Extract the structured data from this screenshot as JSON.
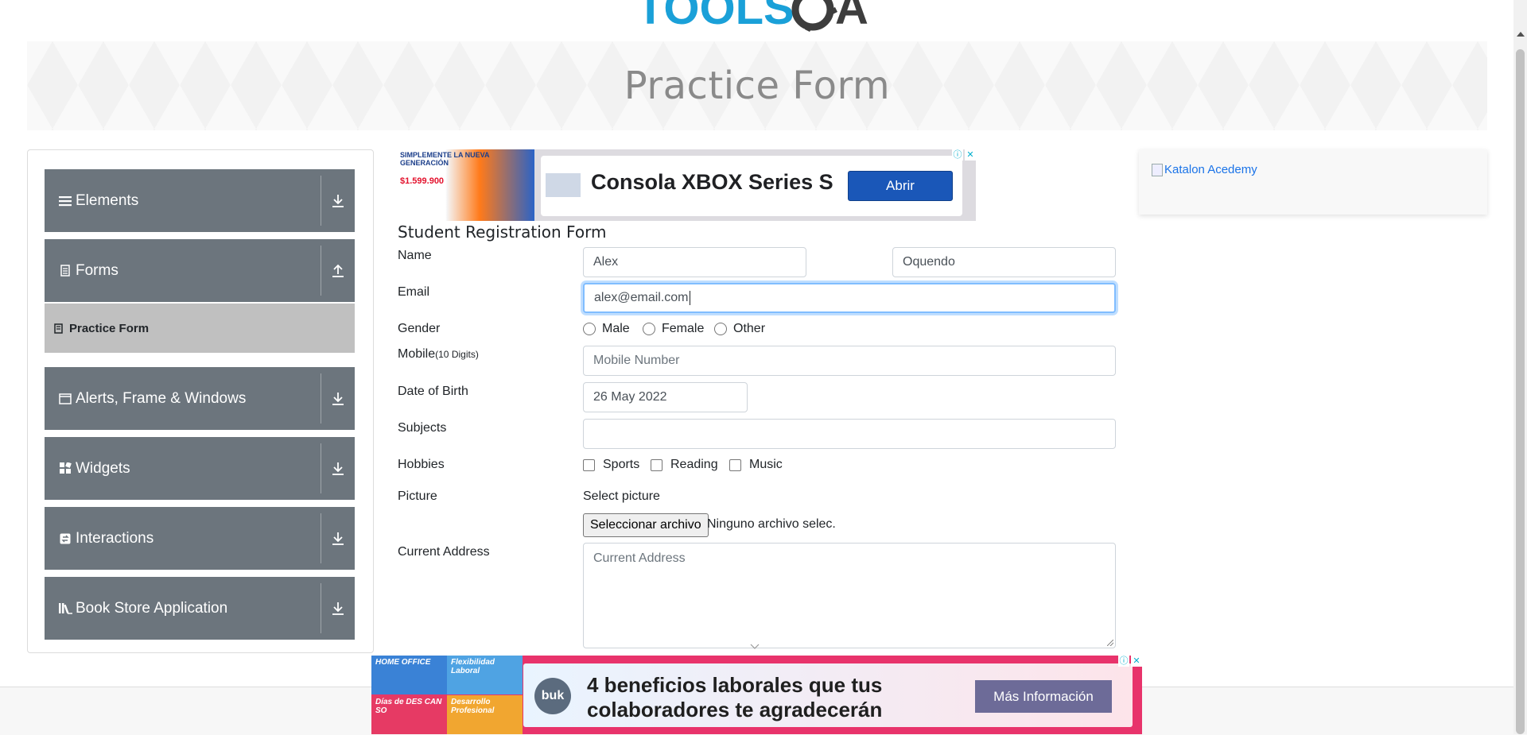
{
  "header": {
    "logo_alt": "TOOLSQA"
  },
  "banner": {
    "title": "Practice Form"
  },
  "sidebar": {
    "groups": [
      {
        "label": "Elements",
        "icon": "menu-lines-icon",
        "arrow": "download-icon"
      },
      {
        "label": "Forms",
        "icon": "document-icon",
        "arrow": "upload-icon"
      },
      {
        "label": "Alerts, Frame & Windows",
        "icon": "window-icon",
        "arrow": "download-icon"
      },
      {
        "label": "Widgets",
        "icon": "widgets-grid-icon",
        "arrow": "download-icon"
      },
      {
        "label": "Interactions",
        "icon": "interactions-icon",
        "arrow": "download-icon"
      },
      {
        "label": "Book Store Application",
        "icon": "books-icon",
        "arrow": "download-icon"
      }
    ],
    "active_sub_item": "Practice Form"
  },
  "ads": {
    "top": {
      "thumb_line1": "SIMPLEMENTE LA NUEVA GENERACIÓN",
      "thumb_price": "$1.599.900",
      "headline": "Consola XBOX Series S",
      "cta": "Abrir"
    },
    "right": {
      "broken_image_alt": "Katalon Acedemy"
    },
    "bottom": {
      "tiles": [
        "HOME OFFICE",
        "Flexibilidad Laboral",
        "Días de DES CAN SO",
        "Desarrollo Profesional"
      ],
      "brand": "buk",
      "line1": "4 beneficios laborales que tus",
      "line2": "colaboradores te agradecerán",
      "cta": "Más Información"
    }
  },
  "form": {
    "title": "Student Registration Form",
    "labels": {
      "name": "Name",
      "email": "Email",
      "gender": "Gender",
      "mobile": "Mobile",
      "mobile_hint": "(10 Digits)",
      "dob": "Date of Birth",
      "subjects": "Subjects",
      "hobbies": "Hobbies",
      "picture": "Picture",
      "address": "Current Address"
    },
    "first_name": "Alex",
    "last_name": "Oquendo",
    "email": "alex@email.com",
    "mobile_placeholder": "Mobile Number",
    "dob": "26 May 2022",
    "subjects": "",
    "gender_options": [
      "Male",
      "Female",
      "Other"
    ],
    "hobby_options": [
      "Sports",
      "Reading",
      "Music"
    ],
    "picture_prompt": "Select picture",
    "file_button": "Seleccionar archivo",
    "file_status": "Ninguno archivo selec.",
    "address_placeholder": "Current Address"
  }
}
